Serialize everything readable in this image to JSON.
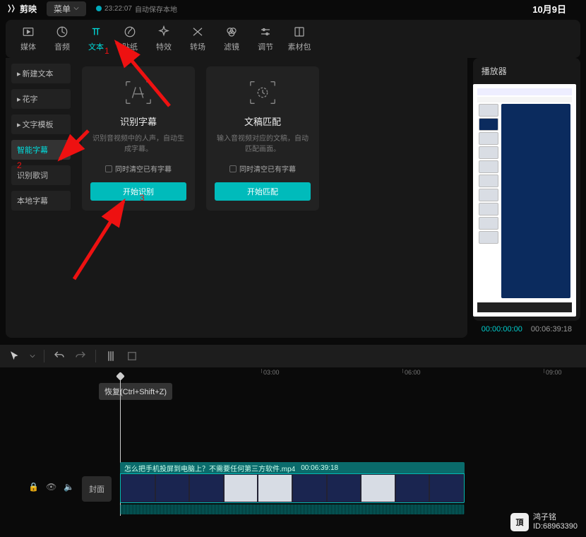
{
  "header": {
    "app_name": "剪映",
    "menu_label": "菜单",
    "autosave_time": "23:22:07",
    "autosave_text": "自动保存本地",
    "date": "10月9日"
  },
  "tabs": [
    {
      "label": "媒体"
    },
    {
      "label": "音频"
    },
    {
      "label": "文本"
    },
    {
      "label": "贴纸"
    },
    {
      "label": "特效"
    },
    {
      "label": "转场"
    },
    {
      "label": "滤镜"
    },
    {
      "label": "调节"
    },
    {
      "label": "素材包"
    }
  ],
  "sidebar": {
    "items": [
      {
        "label": "新建文本"
      },
      {
        "label": "花字"
      },
      {
        "label": "文字模板"
      },
      {
        "label": "智能字幕"
      },
      {
        "label": "识别歌词"
      },
      {
        "label": "本地字幕"
      }
    ]
  },
  "cards": {
    "recognize": {
      "title": "识别字幕",
      "desc": "识别音视频中的人声，自动生成字幕。",
      "check": "同时清空已有字幕",
      "button": "开始识别"
    },
    "match": {
      "title": "文稿匹配",
      "desc": "输入音视频对应的文稿，自动匹配画面。",
      "check": "同时清空已有字幕",
      "button": "开始匹配"
    }
  },
  "player": {
    "title": "播放器",
    "current": "00:00:00:00",
    "total": "00:06:39:18"
  },
  "tooltip": "恢复(Ctrl+Shift+Z)",
  "ruler": [
    "03:00",
    "06:00",
    "09:00"
  ],
  "timeline": {
    "cover": "封面",
    "clip_name": "怎么把手机投屏到电脑上？不需要任何第三方软件.mp4",
    "clip_dur": "00:06:39:18"
  },
  "watermark": {
    "name": "鸿子铭",
    "id": "ID:68963390"
  },
  "annotations": {
    "n1": "1",
    "n2": "2",
    "n3": "3"
  }
}
